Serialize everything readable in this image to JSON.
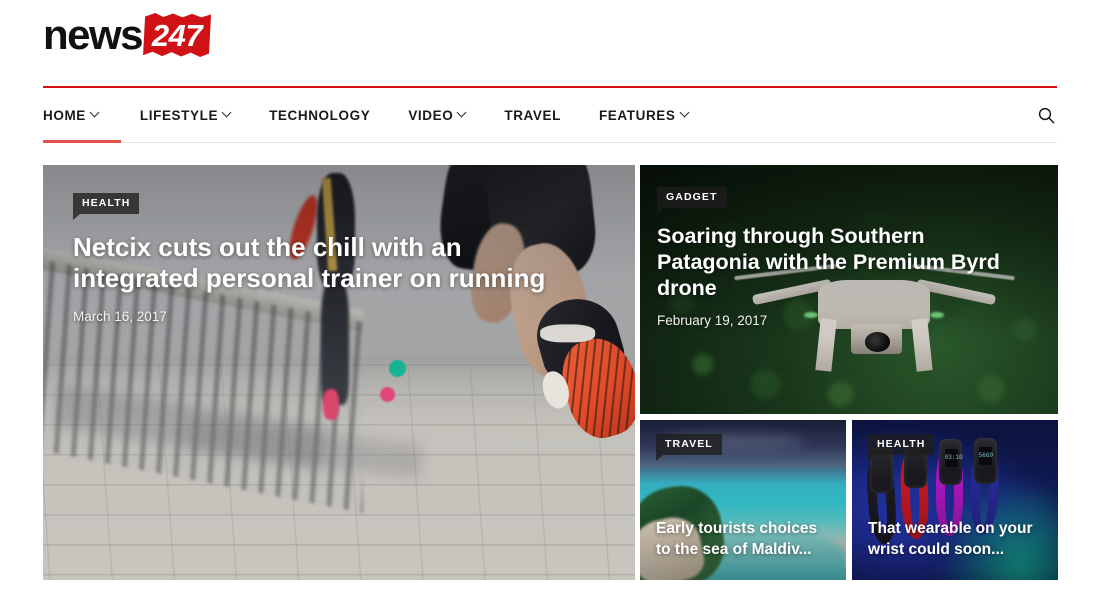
{
  "site": {
    "logo_word": "news",
    "logo_badge": "247",
    "brand_red": "#D01217"
  },
  "nav": {
    "items": [
      {
        "label": "HOME",
        "has_dropdown": true,
        "active": true
      },
      {
        "label": "LIFESTYLE",
        "has_dropdown": true,
        "active": false
      },
      {
        "label": "TECHNOLOGY",
        "has_dropdown": false,
        "active": false
      },
      {
        "label": "VIDEO",
        "has_dropdown": true,
        "active": false
      },
      {
        "label": "TRAVEL",
        "has_dropdown": false,
        "active": false
      },
      {
        "label": "FEATURES",
        "has_dropdown": true,
        "active": false
      }
    ],
    "search_icon": "search-icon"
  },
  "featured": {
    "hero": {
      "category": "HEALTH",
      "title": "Netcix cuts out the chill with an integrated personal trainer on running",
      "date": "March 16, 2017"
    },
    "drone": {
      "category": "GADGET",
      "title": "Soaring through Southern Patagonia with the Premium Byrd drone",
      "date": "February 19, 2017"
    },
    "beach": {
      "category": "TRAVEL",
      "title": "Early tourists choices to the sea of Maldiv..."
    },
    "wearable": {
      "category": "HEALTH",
      "title": "That wearable on your wrist could soon...",
      "screen_1": "03:10",
      "screen_2": "5669"
    }
  }
}
